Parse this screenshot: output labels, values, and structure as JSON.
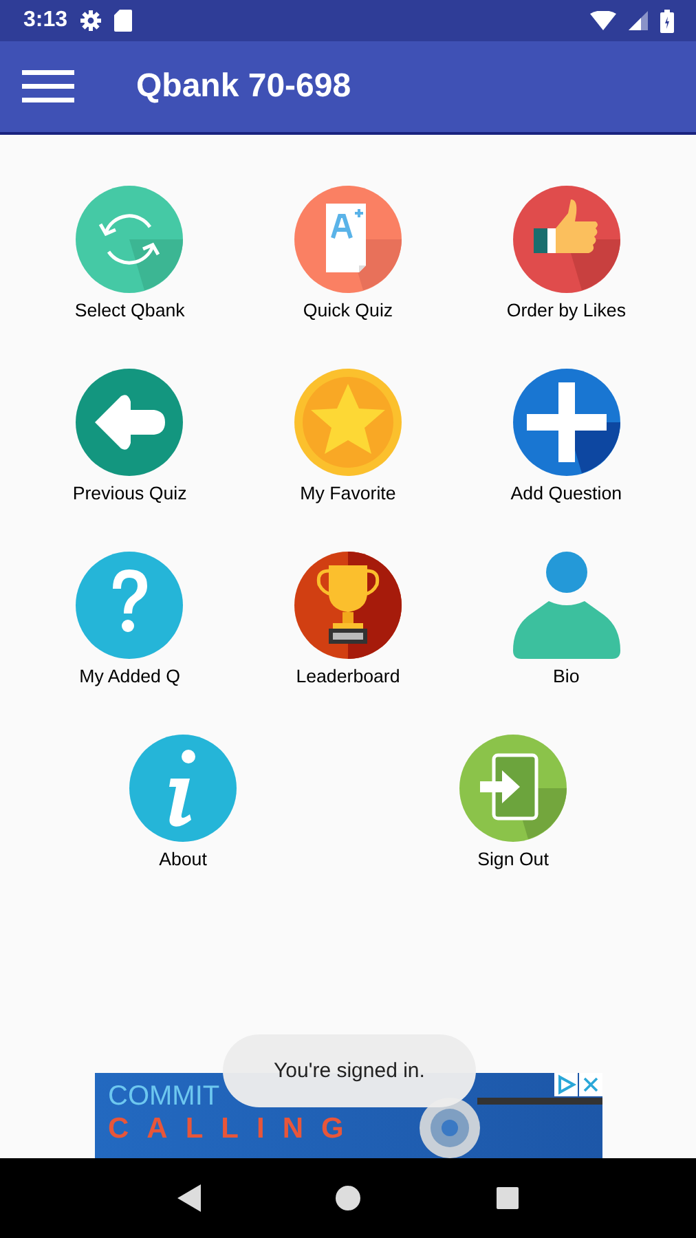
{
  "status_bar": {
    "time": "3:13"
  },
  "app_bar": {
    "title": "Qbank 70-698"
  },
  "menu_rows": [
    [
      {
        "label": "Select Qbank",
        "kind": "refresh"
      },
      {
        "label": "Quick Quiz",
        "kind": "quiz"
      },
      {
        "label": "Order by Likes",
        "kind": "like"
      }
    ],
    [
      {
        "label": "Previous Quiz",
        "kind": "back"
      },
      {
        "label": "My Favorite",
        "kind": "star"
      },
      {
        "label": "Add Question",
        "kind": "plus"
      }
    ],
    [
      {
        "label": "My Added Q",
        "kind": "question"
      },
      {
        "label": "Leaderboard",
        "kind": "trophy"
      },
      {
        "label": "Bio",
        "kind": "person"
      }
    ],
    [
      {
        "label": "About",
        "kind": "info"
      },
      {
        "label": "Sign Out",
        "kind": "signout"
      }
    ]
  ],
  "ad_banner": {
    "headline": "COMMIT",
    "tagline": "CALLING"
  },
  "toast": {
    "message": "You're signed in."
  }
}
